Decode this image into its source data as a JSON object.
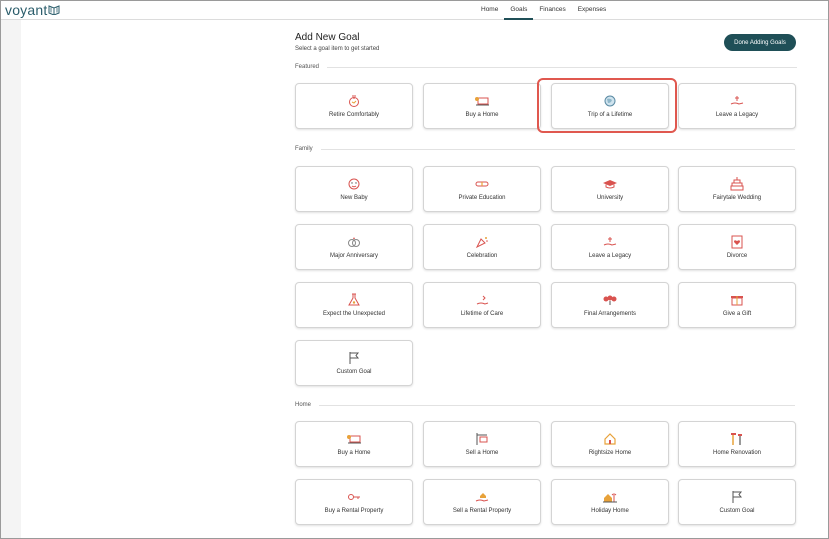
{
  "app": {
    "logo_text": "voyant"
  },
  "nav": {
    "tabs": [
      "Home",
      "Goals",
      "Finances",
      "Expenses"
    ],
    "active": "Goals"
  },
  "header": {
    "title": "Add New Goal",
    "subtitle": "Select a goal item to get started",
    "done_button": "Done Adding Goals"
  },
  "sections": {
    "featured": {
      "label": "Featured",
      "items": [
        "Retire Comfortably",
        "Buy a Home",
        "Trip of a Lifetime",
        "Leave a Legacy"
      ]
    },
    "family": {
      "label": "Family",
      "items": [
        "New Baby",
        "Private Education",
        "University",
        "Fairytale Wedding",
        "Major Anniversary",
        "Celebration",
        "Leave a Legacy",
        "Divorce",
        "Expect the Unexpected",
        "Lifetime of Care",
        "Final Arrangements",
        "Give a Gift",
        "Custom Goal"
      ]
    },
    "home": {
      "label": "Home",
      "items": [
        "Buy a Home",
        "Sell a Home",
        "Rightsize Home",
        "Home Renovation",
        "Buy a Rental Property",
        "Sell a Rental Property",
        "Holiday Home",
        "Custom Goal"
      ]
    }
  },
  "highlighted_item": "Trip of a Lifetime",
  "colors": {
    "accent": "#1f4f57",
    "highlight": "#e0584f",
    "icon_red": "#d9534f",
    "icon_gold": "#e8a23a"
  }
}
